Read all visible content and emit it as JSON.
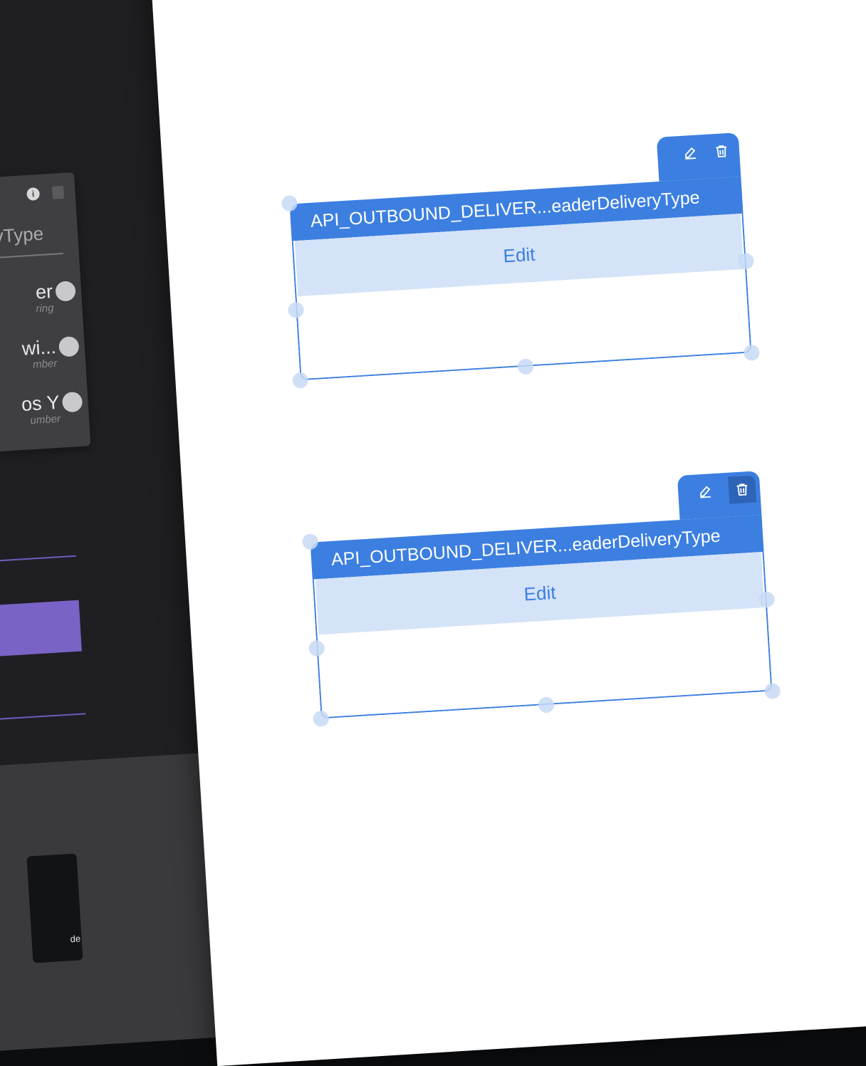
{
  "left_panel": {
    "node": {
      "title_fragment": "yType",
      "fields": [
        {
          "name": "er",
          "type": "ring"
        },
        {
          "name": "wi...",
          "type": "mber"
        },
        {
          "name": "os Y",
          "type": "umber"
        }
      ]
    },
    "mini_node_label": "de",
    "accent_color": "#7a63c6"
  },
  "canvas": {
    "nodes": [
      {
        "title": "API_OUTBOUND_DELIVER...eaderDeliveryType",
        "edit_label": "Edit",
        "tools": [
          "edit-icon",
          "trash-icon"
        ]
      },
      {
        "title": "API_OUTBOUND_DELIVER...eaderDeliveryType",
        "edit_label": "Edit",
        "tools": [
          "edit-icon",
          "trash-icon"
        ]
      }
    ],
    "node_color": "#3c7fe0",
    "edit_row_color": "#d4e3f8"
  }
}
